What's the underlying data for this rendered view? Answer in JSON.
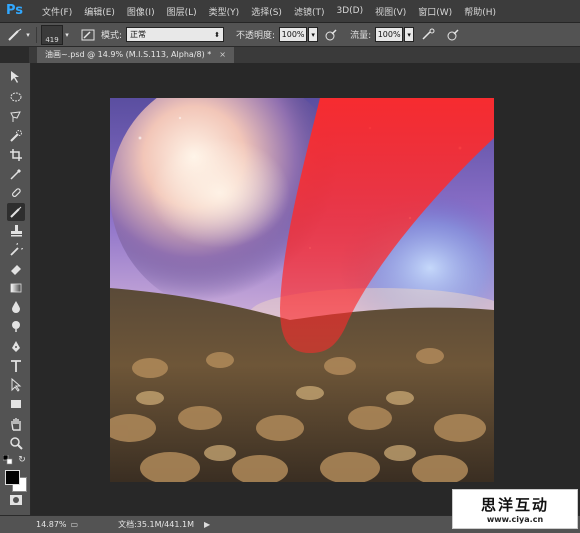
{
  "app": {
    "logo": "Ps"
  },
  "menubar": {
    "items": [
      "文件(F)",
      "编辑(E)",
      "图像(I)",
      "图层(L)",
      "类型(Y)",
      "选择(S)",
      "滤镜(T)",
      "3D(D)",
      "视图(V)",
      "窗口(W)",
      "帮助(H)"
    ]
  },
  "options": {
    "brush_size": "419",
    "mode_label": "模式:",
    "mode_value": "正常",
    "opacity_label": "不透明度:",
    "opacity_value": "100%",
    "flow_label": "流量:",
    "flow_value": "100%"
  },
  "document": {
    "tab_label": "油画~.psd @ 14.9% (M.I.S.113, Alpha/8) *",
    "close_glyph": "×"
  },
  "status": {
    "zoom": "14.87%",
    "doc_info": "文档:35.1M/441.1M"
  },
  "watermark": {
    "main": "思洋互动",
    "url": "www.ciya.cn"
  },
  "colors": {
    "accent": "#31a8ff",
    "mask_red": "#ff2a2a",
    "foreground": "#000000",
    "background": "#ffffff"
  }
}
